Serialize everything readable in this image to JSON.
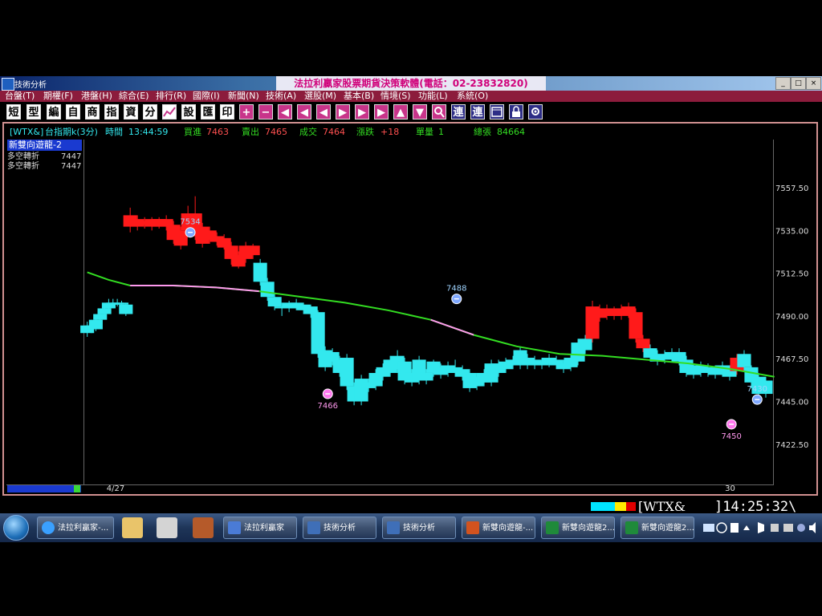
{
  "window": {
    "app_title": "技術分析",
    "main_title": "法拉利贏家股票期貨決策軟體(電話：02-23832820)",
    "buttons": [
      "_",
      "□",
      "×"
    ]
  },
  "menu": [
    "台盤(T)",
    "期權(F)",
    "港盤(H)",
    "綜合(E)",
    "排行(R)",
    "國際(I)",
    "新聞(N)",
    "技術(A)",
    "選股(M)",
    "基本(B)",
    "情境(S)",
    "功能(L)",
    "系統(O)"
  ],
  "toolbar": {
    "char_buttons": [
      "短",
      "型",
      "編",
      "自",
      "商",
      "指",
      "資",
      "分"
    ],
    "char_buttons2": [
      "設",
      "匯",
      "印"
    ],
    "nav_buttons": [
      "+",
      "−",
      "◀",
      "◀",
      "◀",
      "▶",
      "▶",
      "▶",
      "▲",
      "▼"
    ],
    "tail_buttons": [
      "連",
      "連"
    ]
  },
  "info_bar": {
    "symbol": "[WTX&]",
    "name": "台指期k(3分)",
    "time_label": "時間",
    "time_value": "13:44:59",
    "bid_label": "買進",
    "bid_value": "7463",
    "ask_label": "賣出",
    "ask_value": "7465",
    "last_label": "成交",
    "last_value": "7464",
    "change_label": "漲跌",
    "change_value": "+18",
    "volume_label": "單量",
    "volume_value": "1",
    "total_label": "總張",
    "total_value": "84664"
  },
  "indicator": {
    "name": "新雙向遊龍-2",
    "rows": [
      {
        "label": "多空轉折",
        "value": "7447"
      },
      {
        "label": "多空轉折",
        "value": "7447"
      }
    ]
  },
  "chart_data": {
    "type": "candlestick",
    "y_ticks": [
      7557.5,
      7535.0,
      7512.5,
      7490.0,
      7467.5,
      7445.0,
      7422.5
    ],
    "y_tick_labels": [
      "7557.50",
      "7535.00",
      "7512.50",
      "7490.00",
      "7467.50",
      "7445.00",
      "7422.50"
    ],
    "ylim": [
      7403,
      7582
    ],
    "x_labels": [
      {
        "label": "4/27",
        "index": 6
      },
      {
        "label": "30",
        "index": 102
      }
    ],
    "bar_count": 106,
    "colors": {
      "up": "#ff1a1a",
      "down": "#33e8ee",
      "ma": "#33dd22",
      "ma_bear": "#ff99ee"
    },
    "candles": [
      {
        "o": 7481,
        "c": 7485,
        "h": 7487,
        "l": 7479,
        "t": "d"
      },
      {
        "o": 7485,
        "c": 7483,
        "h": 7488,
        "l": 7481,
        "t": "d"
      },
      {
        "o": 7483,
        "c": 7488,
        "h": 7490,
        "l": 7482,
        "t": "d"
      },
      {
        "o": 7488,
        "c": 7491,
        "h": 7493,
        "l": 7486,
        "t": "d"
      },
      {
        "o": 7491,
        "c": 7494,
        "h": 7496,
        "l": 7489,
        "t": "d"
      },
      {
        "o": 7494,
        "c": 7497,
        "h": 7499,
        "l": 7492,
        "t": "d"
      },
      {
        "o": 7497,
        "c": 7496,
        "h": 7499,
        "l": 7494,
        "t": "d"
      },
      {
        "o": 7496,
        "c": 7497,
        "h": 7499,
        "l": 7495,
        "t": "d"
      },
      {
        "o": 7497,
        "c": 7496,
        "h": 7498,
        "l": 7494,
        "t": "d"
      },
      {
        "o": 7496,
        "c": 7491,
        "h": 7497,
        "l": 7490,
        "t": "d"
      },
      {
        "o": 0,
        "c": 0,
        "h": 0,
        "l": 0,
        "t": "gap"
      },
      {
        "o": 0,
        "c": 0,
        "h": 0,
        "l": 0,
        "t": "gap"
      },
      {
        "o": 0,
        "c": 0,
        "h": 0,
        "l": 0,
        "t": "gap"
      },
      {
        "o": 0,
        "c": 0,
        "h": 0,
        "l": 0,
        "t": "gap"
      },
      {
        "o": 0,
        "c": 0,
        "h": 0,
        "l": 0,
        "t": "gap"
      },
      {
        "o": 0,
        "c": 0,
        "h": 0,
        "l": 0,
        "t": "gap"
      },
      {
        "o": 0,
        "c": 0,
        "h": 0,
        "l": 0,
        "t": "gap"
      },
      {
        "o": 7543,
        "c": 7537,
        "h": 7547,
        "l": 7534,
        "t": "u"
      },
      {
        "o": 7541,
        "c": 7537,
        "h": 7543,
        "l": 7535,
        "t": "u"
      },
      {
        "o": 7540,
        "c": 7538,
        "h": 7542,
        "l": 7536,
        "t": "u"
      },
      {
        "o": 7541,
        "c": 7537,
        "h": 7542,
        "l": 7535,
        "t": "u"
      },
      {
        "o": 7541,
        "c": 7537,
        "h": 7542,
        "l": 7536,
        "t": "u"
      },
      {
        "o": 7541,
        "c": 7537,
        "h": 7543,
        "l": 7535,
        "t": "u"
      },
      {
        "o": 7538,
        "c": 7530,
        "h": 7540,
        "l": 7528,
        "t": "u"
      },
      {
        "o": 7535,
        "c": 7527,
        "h": 7537,
        "l": 7525,
        "t": "u"
      },
      {
        "o": 7544,
        "c": 7535,
        "h": 7548,
        "l": 7533,
        "t": "u"
      },
      {
        "o": 7544,
        "c": 7532,
        "h": 7553,
        "l": 7530,
        "t": "u"
      },
      {
        "o": 7537,
        "c": 7528,
        "h": 7539,
        "l": 7526,
        "t": "u"
      },
      {
        "o": 7535,
        "c": 7530,
        "h": 7537,
        "l": 7528,
        "t": "u"
      },
      {
        "o": 7532,
        "c": 7529,
        "h": 7534,
        "l": 7527,
        "t": "u"
      },
      {
        "o": 7531,
        "c": 7526,
        "h": 7533,
        "l": 7525,
        "t": "u"
      },
      {
        "o": 7527,
        "c": 7520,
        "h": 7529,
        "l": 7517,
        "t": "u"
      },
      {
        "o": 7522,
        "c": 7516,
        "h": 7524,
        "l": 7515,
        "t": "u"
      },
      {
        "o": 7527,
        "c": 7520,
        "h": 7529,
        "l": 7518,
        "t": "u"
      },
      {
        "o": 7527,
        "c": 7522,
        "h": 7528,
        "l": 7520,
        "t": "u"
      },
      {
        "o": 7518,
        "c": 7508,
        "h": 7520,
        "l": 7506,
        "t": "d"
      },
      {
        "o": 7508,
        "c": 7500,
        "h": 7510,
        "l": 7498,
        "t": "d"
      },
      {
        "o": 7500,
        "c": 7495,
        "h": 7502,
        "l": 7493,
        "t": "d"
      },
      {
        "o": 7495,
        "c": 7494,
        "h": 7497,
        "l": 7490,
        "t": "d"
      },
      {
        "o": 7497,
        "c": 7494,
        "h": 7498,
        "l": 7492,
        "t": "d"
      },
      {
        "o": 7497,
        "c": 7494,
        "h": 7499,
        "l": 7493,
        "t": "d"
      },
      {
        "o": 7496,
        "c": 7493,
        "h": 7497,
        "l": 7491,
        "t": "d"
      },
      {
        "o": 7495,
        "c": 7491,
        "h": 7496,
        "l": 7489,
        "t": "d"
      },
      {
        "o": 7492,
        "c": 7470,
        "h": 7493,
        "l": 7468,
        "t": "d"
      },
      {
        "o": 7472,
        "c": 7463,
        "h": 7474,
        "l": 7461,
        "t": "d"
      },
      {
        "o": 7471,
        "c": 7466,
        "h": 7473,
        "l": 7464,
        "t": "d"
      },
      {
        "o": 7467,
        "c": 7460,
        "h": 7469,
        "l": 7458,
        "t": "d"
      },
      {
        "o": 7468,
        "c": 7453,
        "h": 7470,
        "l": 7451,
        "t": "d"
      },
      {
        "o": 7453,
        "c": 7445,
        "h": 7455,
        "l": 7443,
        "t": "d"
      },
      {
        "o": 7457,
        "c": 7445,
        "h": 7459,
        "l": 7443,
        "t": "d"
      },
      {
        "o": 7455,
        "c": 7452,
        "h": 7457,
        "l": 7450,
        "t": "d"
      },
      {
        "o": 7460,
        "c": 7453,
        "h": 7462,
        "l": 7451,
        "t": "d"
      },
      {
        "o": 7463,
        "c": 7458,
        "h": 7465,
        "l": 7456,
        "t": "d"
      },
      {
        "o": 7467,
        "c": 7460,
        "h": 7469,
        "l": 7458,
        "t": "d"
      },
      {
        "o": 7469,
        "c": 7462,
        "h": 7472,
        "l": 7460,
        "t": "d"
      },
      {
        "o": 7466,
        "c": 7456,
        "h": 7468,
        "l": 7454,
        "t": "d"
      },
      {
        "o": 7460,
        "c": 7455,
        "h": 7462,
        "l": 7453,
        "t": "d"
      },
      {
        "o": 7467,
        "c": 7456,
        "h": 7469,
        "l": 7454,
        "t": "d"
      },
      {
        "o": 7460,
        "c": 7456,
        "h": 7462,
        "l": 7454,
        "t": "d"
      },
      {
        "o": 7466,
        "c": 7460,
        "h": 7467,
        "l": 7458,
        "t": "d"
      },
      {
        "o": 7463,
        "c": 7459,
        "h": 7465,
        "l": 7457,
        "t": "d"
      },
      {
        "o": 7464,
        "c": 7460,
        "h": 7466,
        "l": 7458,
        "t": "d"
      },
      {
        "o": 7463,
        "c": 7460,
        "h": 7467,
        "l": 7458,
        "t": "d"
      },
      {
        "o": 7462,
        "c": 7458,
        "h": 7464,
        "l": 7456,
        "t": "d"
      },
      {
        "o": 7460,
        "c": 7452,
        "h": 7462,
        "l": 7450,
        "t": "d"
      },
      {
        "o": 7458,
        "c": 7453,
        "h": 7460,
        "l": 7451,
        "t": "d"
      },
      {
        "o": 7460,
        "c": 7455,
        "h": 7462,
        "l": 7453,
        "t": "d"
      },
      {
        "o": 7465,
        "c": 7455,
        "h": 7467,
        "l": 7453,
        "t": "d"
      },
      {
        "o": 7465,
        "c": 7460,
        "h": 7467,
        "l": 7458,
        "t": "d"
      },
      {
        "o": 7466,
        "c": 7462,
        "h": 7468,
        "l": 7460,
        "t": "d"
      },
      {
        "o": 7467,
        "c": 7464,
        "h": 7469,
        "l": 7462,
        "t": "d"
      },
      {
        "o": 7472,
        "c": 7464,
        "h": 7474,
        "l": 7462,
        "t": "d"
      },
      {
        "o": 7468,
        "c": 7464,
        "h": 7470,
        "l": 7462,
        "t": "d"
      },
      {
        "o": 7467,
        "c": 7464,
        "h": 7469,
        "l": 7462,
        "t": "d"
      },
      {
        "o": 7466,
        "c": 7464,
        "h": 7468,
        "l": 7462,
        "t": "d"
      },
      {
        "o": 7468,
        "c": 7465,
        "h": 7470,
        "l": 7463,
        "t": "d"
      },
      {
        "o": 7467,
        "c": 7464,
        "h": 7469,
        "l": 7462,
        "t": "d"
      },
      {
        "o": 7465,
        "c": 7462,
        "h": 7467,
        "l": 7460,
        "t": "d"
      },
      {
        "o": 7468,
        "c": 7463,
        "h": 7470,
        "l": 7461,
        "t": "d"
      },
      {
        "o": 7476,
        "c": 7466,
        "h": 7478,
        "l": 7464,
        "t": "d"
      },
      {
        "o": 7478,
        "c": 7472,
        "h": 7480,
        "l": 7470,
        "t": "d"
      },
      {
        "o": 7495,
        "c": 7478,
        "h": 7498,
        "l": 7476,
        "t": "u"
      },
      {
        "o": 7494,
        "c": 7489,
        "h": 7496,
        "l": 7487,
        "t": "u"
      },
      {
        "o": 7494,
        "c": 7490,
        "h": 7496,
        "l": 7488,
        "t": "u"
      },
      {
        "o": 7493,
        "c": 7490,
        "h": 7495,
        "l": 7488,
        "t": "u"
      },
      {
        "o": 7494,
        "c": 7490,
        "h": 7496,
        "l": 7488,
        "t": "u"
      },
      {
        "o": 7495,
        "c": 7491,
        "h": 7497,
        "l": 7489,
        "t": "u"
      },
      {
        "o": 7492,
        "c": 7478,
        "h": 7494,
        "l": 7476,
        "t": "u"
      },
      {
        "o": 7478,
        "c": 7473,
        "h": 7480,
        "l": 7471,
        "t": "u"
      },
      {
        "o": 7473,
        "c": 7468,
        "h": 7475,
        "l": 7466,
        "t": "d"
      },
      {
        "o": 7470,
        "c": 7466,
        "h": 7472,
        "l": 7464,
        "t": "d"
      },
      {
        "o": 7470,
        "c": 7467,
        "h": 7472,
        "l": 7465,
        "t": "d"
      },
      {
        "o": 7471,
        "c": 7468,
        "h": 7473,
        "l": 7466,
        "t": "d"
      },
      {
        "o": 7471,
        "c": 7466,
        "h": 7473,
        "l": 7464,
        "t": "d"
      },
      {
        "o": 7467,
        "c": 7460,
        "h": 7469,
        "l": 7458,
        "t": "d"
      },
      {
        "o": 7463,
        "c": 7459,
        "h": 7465,
        "l": 7457,
        "t": "d"
      },
      {
        "o": 7464,
        "c": 7460,
        "h": 7466,
        "l": 7458,
        "t": "d"
      },
      {
        "o": 7463,
        "c": 7460,
        "h": 7465,
        "l": 7458,
        "t": "d"
      },
      {
        "o": 7462,
        "c": 7459,
        "h": 7464,
        "l": 7457,
        "t": "d"
      },
      {
        "o": 7464,
        "c": 7460,
        "h": 7466,
        "l": 7458,
        "t": "d"
      },
      {
        "o": 7462,
        "c": 7458,
        "h": 7464,
        "l": 7456,
        "t": "d"
      },
      {
        "o": 7468,
        "c": 7461,
        "h": 7470,
        "l": 7459,
        "t": "u"
      },
      {
        "o": 7470,
        "c": 7463,
        "h": 7472,
        "l": 7461,
        "t": "d"
      },
      {
        "o": 7463,
        "c": 7455,
        "h": 7464,
        "l": 7452,
        "t": "d"
      },
      {
        "o": 7458,
        "c": 7449,
        "h": 7460,
        "l": 7447,
        "t": "d"
      },
      {
        "o": 7456,
        "c": 7449,
        "h": 7458,
        "l": 7447,
        "t": "d"
      }
    ],
    "ma_line": [
      [
        0,
        7513
      ],
      [
        5,
        7509
      ],
      [
        10,
        7506
      ],
      [
        20,
        7506
      ],
      [
        30,
        7505
      ],
      [
        40,
        7503
      ],
      [
        50,
        7500
      ],
      [
        60,
        7497
      ],
      [
        70,
        7493
      ],
      [
        80,
        7488
      ],
      [
        90,
        7480
      ],
      [
        100,
        7474
      ],
      [
        110,
        7470
      ],
      [
        120,
        7469
      ],
      [
        130,
        7467
      ],
      [
        140,
        7465
      ],
      [
        150,
        7462
      ],
      [
        160,
        7458
      ]
    ],
    "ma_bear_ranges": [
      [
        10,
        40
      ],
      [
        80,
        90
      ]
    ],
    "annotations": [
      {
        "label": "7534",
        "index": 24,
        "value": 7534,
        "kind": "sell",
        "text_above": true
      },
      {
        "label": "7466",
        "index": 56,
        "value": 7449,
        "kind": "buy",
        "text_above": false
      },
      {
        "label": "7488",
        "index": 86,
        "value": 7499,
        "kind": "sell",
        "text_above": true
      },
      {
        "label": "7430",
        "index": 156,
        "value": 7446,
        "kind": "sell",
        "text_above": true
      },
      {
        "label": "7450",
        "index": 150,
        "value": 7433,
        "kind": "buy",
        "text_above": false
      }
    ]
  },
  "status": {
    "symbol": "[WTX&_",
    "time": "]14:25:32\\"
  },
  "taskbar": {
    "tasks": [
      "法拉利贏家-...",
      "法拉利贏家",
      "技術分析",
      "技術分析",
      "新雙向遊龍-...",
      "新雙向遊龍2...",
      "新雙向遊龍2..."
    ]
  }
}
